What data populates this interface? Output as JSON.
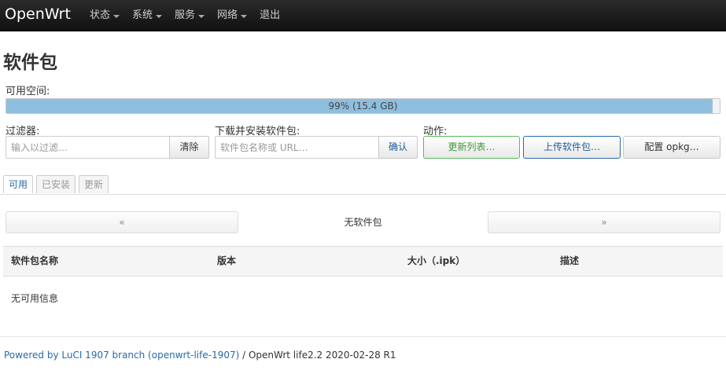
{
  "nav": {
    "brand": "OpenWrt",
    "items": [
      {
        "label": "状态",
        "dropdown": true
      },
      {
        "label": "系统",
        "dropdown": true
      },
      {
        "label": "服务",
        "dropdown": true
      },
      {
        "label": "网络",
        "dropdown": true
      },
      {
        "label": "退出",
        "dropdown": false
      }
    ]
  },
  "page": {
    "title": "软件包"
  },
  "space": {
    "label": "可用空间:",
    "percent": 99,
    "text": "99% (15.4 GB)"
  },
  "filter": {
    "label": "过滤器:",
    "placeholder": "输入以过滤…",
    "clear_label": "清除"
  },
  "install": {
    "label": "下载并安装软件包:",
    "placeholder": "软件包名称或 URL…",
    "confirm_label": "确认"
  },
  "actions": {
    "label": "动作:",
    "update_label": "更新列表…",
    "upload_label": "上传软件包…",
    "configure_label": "配置 opkg…"
  },
  "tabs": [
    {
      "label": "可用",
      "active": true
    },
    {
      "label": "已安装",
      "active": false
    },
    {
      "label": "更新",
      "active": false
    }
  ],
  "pager": {
    "prev": "«",
    "status": "无软件包",
    "next": "»"
  },
  "table": {
    "columns": [
      "软件包名称",
      "版本",
      "大小（.ipk）",
      "描述"
    ],
    "empty_text": "无可用信息"
  },
  "footer": {
    "link_text": "Powered by LuCI 1907 branch (openwrt-life-1907)",
    "version_text": " / OpenWrt life2.2 2020-02-28 R1"
  },
  "colors": {
    "navbar": "#1f1f1f",
    "progress_fill": "#8fbfdf",
    "update_button": "#5cb85c",
    "upload_button": "#2a6aa8"
  }
}
